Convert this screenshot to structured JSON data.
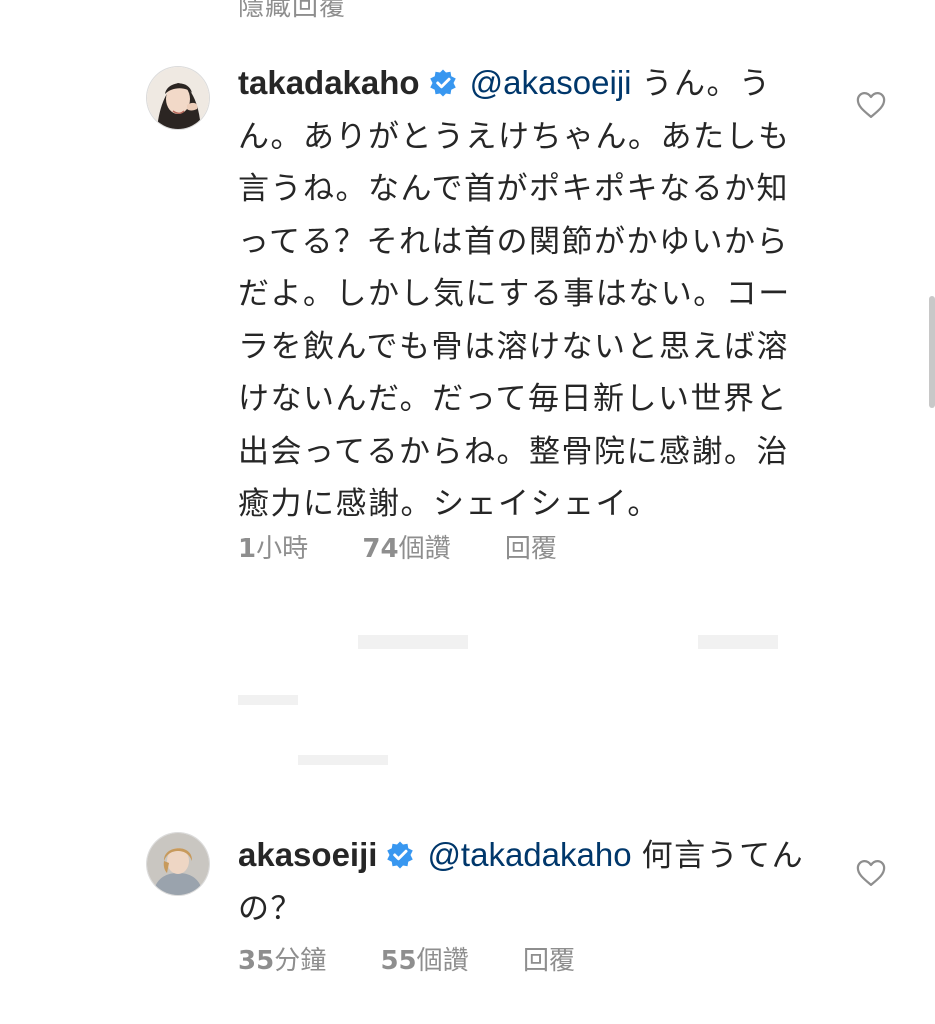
{
  "hidden_replies_label": "隱藏回覆",
  "comments": [
    {
      "username": "takadakaho",
      "verified": true,
      "mention": "@akasoeiji",
      "text": "うん。うん。ありがとうえけちゃん。あたしも言うね。なんで首がポキポキなるか知ってる？それは首の関節がかゆいからだよ。しかし気にする事はない。コーラを飲んでも骨は溶けないと思えば溶けないんだ。だって毎日新しい世界と出会ってるからね。整骨院に感謝。治癒力に感謝。シェイシェイ。",
      "time": "1小時",
      "likes": "74個讚",
      "reply_label": "回覆"
    },
    {
      "username": "akasoeiji",
      "verified": true,
      "mention": "@takadakaho",
      "text": "何言うてんの？",
      "time": "35分鐘",
      "likes": "55個讚",
      "reply_label": "回覆"
    }
  ],
  "icons": {
    "like": "heart-outline-icon",
    "verified": "verified-badge-icon"
  },
  "colors": {
    "text": "#262626",
    "secondary": "#8e8e8e",
    "mention": "#00376b",
    "verified": "#3897f0"
  }
}
